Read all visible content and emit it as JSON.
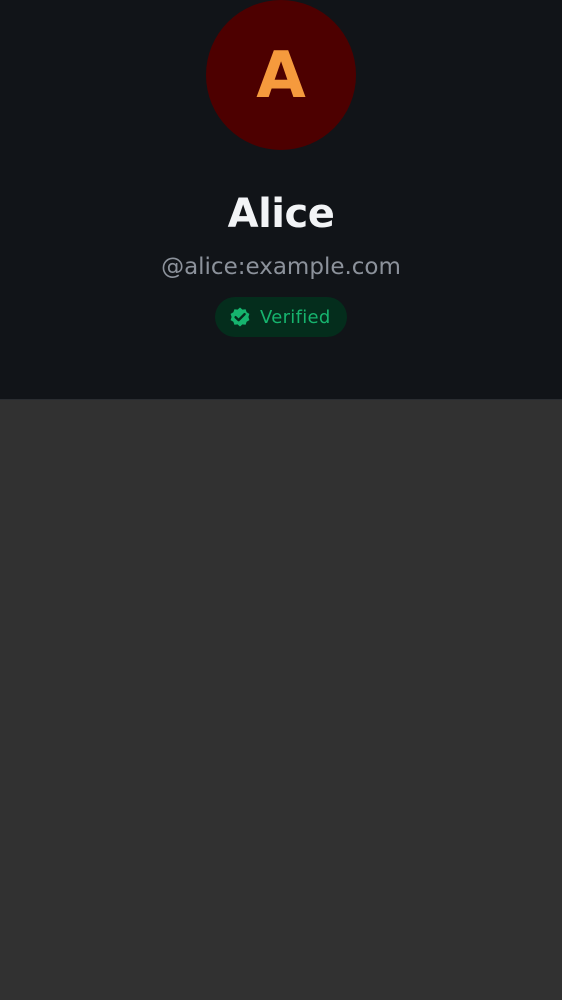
{
  "profile": {
    "avatar_initial": "A",
    "display_name": "Alice",
    "user_id": "@alice:example.com",
    "verification": {
      "label": "Verified",
      "icon": "verified-badge-icon"
    }
  },
  "colors": {
    "header_background": "#111418",
    "avatar_background": "#4d0000",
    "avatar_text": "#f59a3d",
    "name_text": "#f2f4f6",
    "user_id_text": "#8c929b",
    "verified_accent": "#16b46e",
    "verified_background": "#042d1c",
    "content_background": "#313131"
  }
}
